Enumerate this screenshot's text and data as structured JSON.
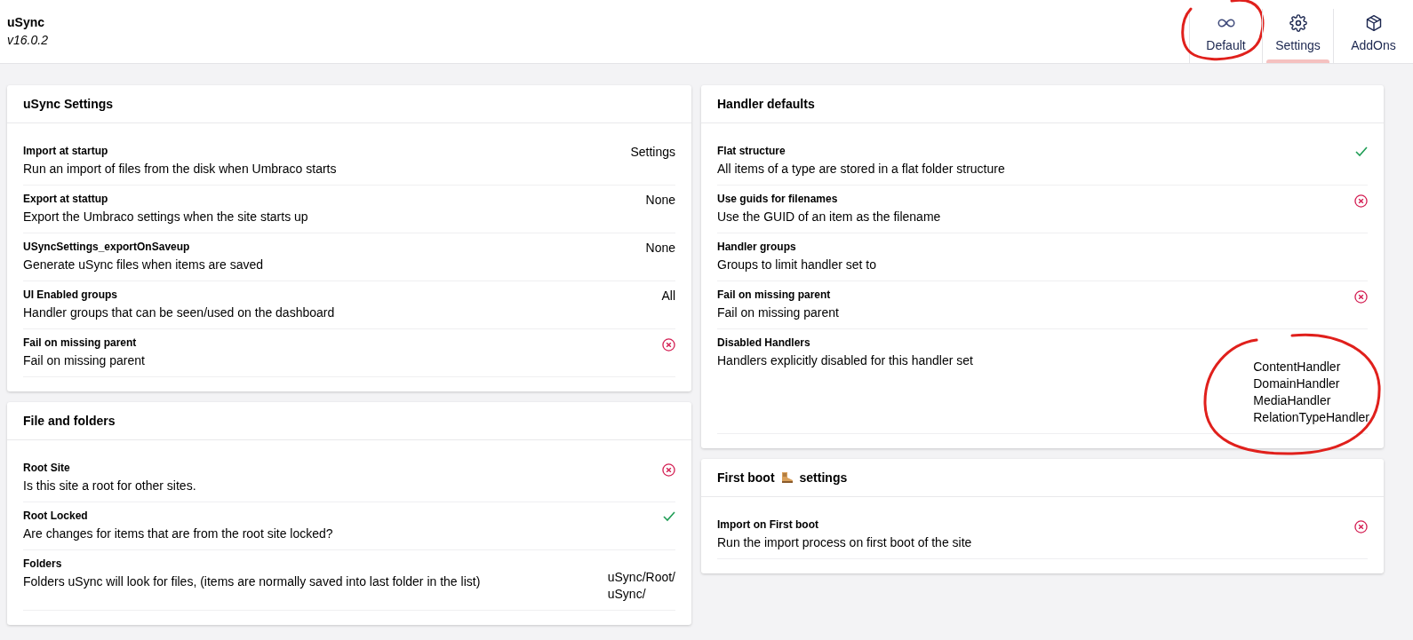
{
  "header": {
    "title": "uSync",
    "version": "v16.0.2"
  },
  "tabs": [
    {
      "label": "Default",
      "kind": "infinity",
      "selected": false,
      "circled": true
    },
    {
      "label": "Settings",
      "kind": "gear",
      "selected": true,
      "circled": false
    },
    {
      "label": "AddOns",
      "kind": "box",
      "selected": false,
      "circled": false
    }
  ],
  "columns": [
    {
      "cards": [
        {
          "title": "uSync Settings",
          "rows": [
            {
              "label": "Import at startup",
              "description": "Run an import of files from the disk when Umbraco starts",
              "kind": "text",
              "value": "Settings"
            },
            {
              "label": "Export at stattup",
              "description": "Export the Umbraco settings when the site starts up",
              "kind": "text",
              "value": "None"
            },
            {
              "label": "USyncSettings_exportOnSaveup",
              "description": "Generate uSync files when items are saved",
              "kind": "text",
              "value": "None"
            },
            {
              "label": "UI Enabled groups",
              "description": "Handler groups that can be seen/used on the dashboard",
              "kind": "text",
              "value": "All"
            },
            {
              "label": "Fail on missing parent",
              "description": "Fail on missing parent",
              "kind": "bool",
              "on": false
            }
          ]
        },
        {
          "title": "File and folders",
          "rows": [
            {
              "label": "Root Site",
              "description": "Is this site a root for other sites.",
              "kind": "bool",
              "on": false
            },
            {
              "label": "Root Locked",
              "description": "Are changes for items that are from the root site locked?",
              "kind": "bool",
              "on": true
            },
            {
              "label": "Folders",
              "description": "Folders uSync will look for files, (items are normally saved into last folder in the list)",
              "kind": "list",
              "values": [
                "uSync/Root/",
                "uSync/"
              ]
            }
          ]
        }
      ]
    },
    {
      "cards": [
        {
          "title": "Handler defaults",
          "rows": [
            {
              "label": "Flat structure",
              "description": "All items of a type are stored in a flat folder structure",
              "kind": "bool",
              "on": true
            },
            {
              "label": "Use guids for filenames",
              "description": "Use the GUID of an item as the filename",
              "kind": "bool",
              "on": false
            },
            {
              "label": "Handler groups",
              "description": "Groups to limit handler set to",
              "kind": "empty"
            },
            {
              "label": "Fail on missing parent",
              "description": "Fail on missing parent",
              "kind": "bool",
              "on": false
            },
            {
              "label": "Disabled Handlers",
              "description": "Handlers explicitly disabled for this handler set",
              "kind": "list",
              "values": [
                "ContentHandler",
                "DomainHandler",
                "MediaHandler",
                "RelationTypeHandler"
              ],
              "circled": true
            }
          ]
        },
        {
          "title": "First boot",
          "title_after": "settings",
          "rows": [
            {
              "label": "Import on First boot",
              "description": "Run the import process on first boot of the site",
              "kind": "bool",
              "on": false
            }
          ]
        }
      ]
    }
  ]
}
